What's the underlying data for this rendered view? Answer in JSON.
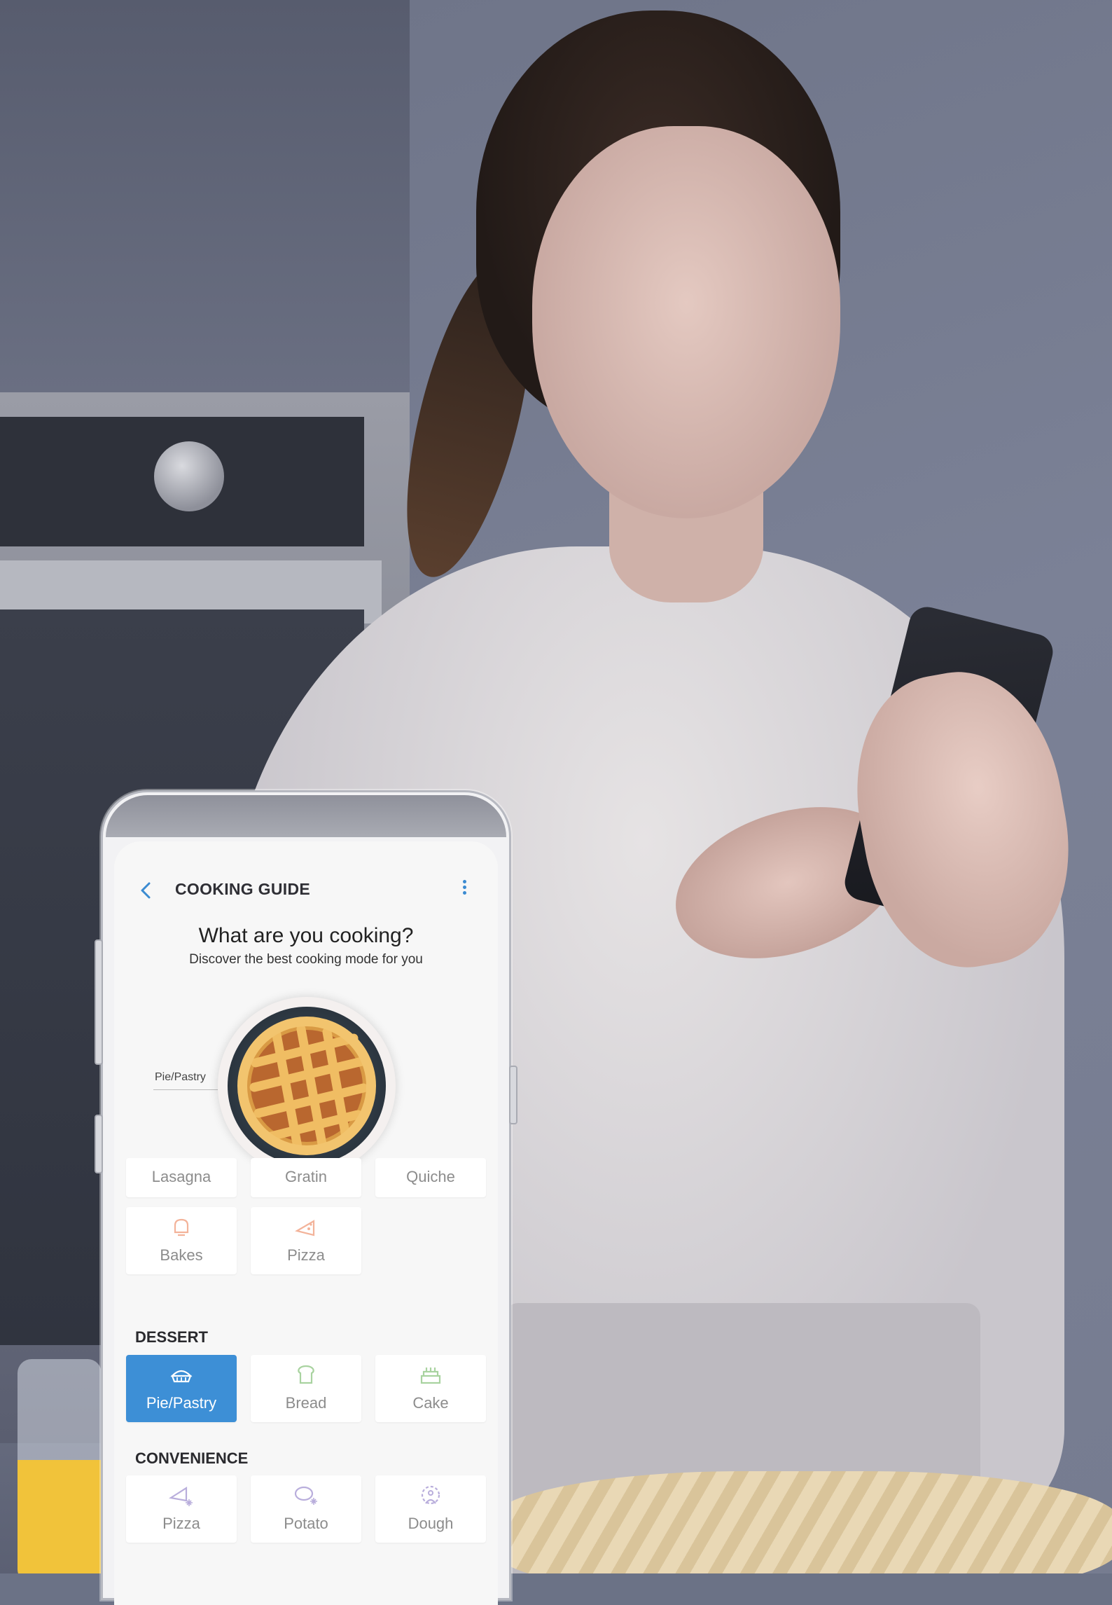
{
  "header": {
    "title": "COOKING GUIDE",
    "headline": "What are you cooking?",
    "subhead": "Discover the best cooking mode for you"
  },
  "selected_dish": {
    "label": "Pie/Pastry"
  },
  "main_tiles": [
    {
      "label": "Lasagna"
    },
    {
      "label": "Gratin"
    },
    {
      "label": "Quiche"
    },
    {
      "label": "Bakes",
      "icon": "bakes-icon"
    },
    {
      "label": "Pizza",
      "icon": "pizza-icon"
    }
  ],
  "dessert": {
    "title": "DESSERT",
    "tiles": [
      {
        "label": "Pie/Pastry",
        "icon": "pie-icon",
        "selected": true
      },
      {
        "label": "Bread",
        "icon": "bread-icon"
      },
      {
        "label": "Cake",
        "icon": "cake-icon"
      }
    ]
  },
  "convenience": {
    "title": "CONVENIENCE",
    "tiles": [
      {
        "label": "Pizza",
        "icon": "frozen-pizza-icon"
      },
      {
        "label": "Potato",
        "icon": "frozen-potato-icon"
      },
      {
        "label": "Dough",
        "icon": "dough-icon"
      }
    ]
  },
  "colors": {
    "accent": "#3d8fd6",
    "muted_icon_orange": "#f3b39a",
    "muted_icon_green": "#a9d3a0",
    "muted_icon_purple": "#b9aedc"
  }
}
